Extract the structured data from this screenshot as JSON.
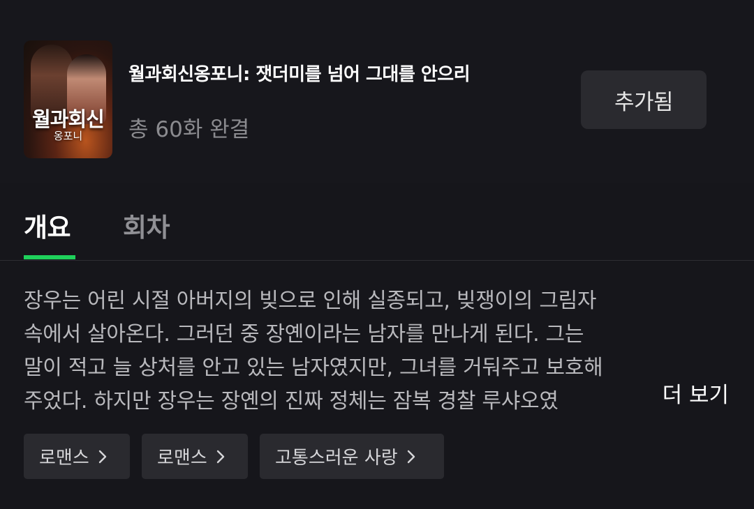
{
  "show": {
    "cover_title": "월과회신",
    "cover_subtitle": "옹포니",
    "title": "월과회신옹포니: 잿더미를 넘어 그대를 안으리",
    "episodes": "총 60화 완결",
    "added_label": "추가됨"
  },
  "tabs": [
    {
      "label": "개요",
      "active": true
    },
    {
      "label": "회차",
      "active": false
    }
  ],
  "synopsis": {
    "lines": [
      "장우는 어린 시절 아버지의 빚으로 인해 실종되고, 빚쟁이의 그림자",
      "속에서 살아온다. 그러던 중 장옌이라는 남자를 만나게 된다. 그는",
      "말이 적고 늘 상처를 안고 있는 남자였지만, 그녀를 거둬주고 보호해",
      "주었다. 하지만 장우는 장옌의 진짜 정체는 잠복 경찰 루샤오였"
    ],
    "more_label": "더 보기"
  },
  "tags": [
    {
      "label": "로맨스"
    },
    {
      "label": "로맨스"
    },
    {
      "label": "고통스러운 사랑"
    }
  ],
  "colors": {
    "accent": "#1fd15b",
    "background": "#16161b",
    "button": "#2a2a2f"
  },
  "icons": {
    "tag_arrow": "chevron-right-icon"
  }
}
